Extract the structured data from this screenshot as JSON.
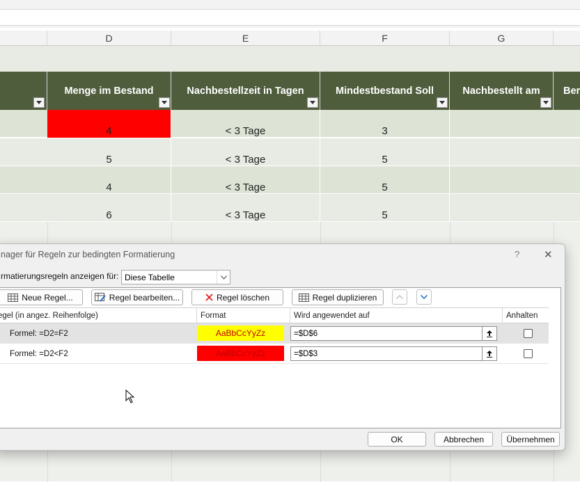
{
  "sheet": {
    "columns": [
      "D",
      "E",
      "F",
      "G"
    ],
    "headers": [
      "Menge im Bestand",
      "Nachbestellzeit in Tagen",
      "Mindestbestand Soll",
      "Nachbestellt am",
      "Ber"
    ],
    "rows": [
      {
        "d": "4",
        "e": "< 3 Tage",
        "f": "3",
        "highlight": "#ff0000"
      },
      {
        "d": "5",
        "e": "< 3 Tage",
        "f": "5"
      },
      {
        "d": "4",
        "e": "< 3 Tage",
        "f": "5"
      },
      {
        "d": "6",
        "e": "< 3 Tage",
        "f": "5"
      }
    ],
    "colors": {
      "header_bg": "#4f5d3c",
      "row_band_a": "#dde3d5",
      "row_band_b": "#e8ebe4"
    }
  },
  "dialog": {
    "title": "nager für Regeln zur bedingten Formatierung",
    "help": "?",
    "close": "✕",
    "show_label": "rmatierungsregeln anzeigen für:",
    "scope_value": "Diese Tabelle",
    "toolbar": {
      "new_rule": "Neue Regel...",
      "edit_rule": "Regel bearbeiten...",
      "delete_rule": "Regel löschen",
      "duplicate_rule": "Regel duplizieren"
    },
    "columns": {
      "rule": "egel (in angez. Reihenfolge)",
      "format": "Format",
      "applies_to": "Wird angewendet auf",
      "stop": "Anhalten"
    },
    "rules": [
      {
        "rule": "Formel: =D2=F2",
        "preview": "AaBbCcYyZz",
        "preview_bg": "#ffff00",
        "preview_fg": "#c00000",
        "applies_to": "=$D$6",
        "stop": false
      },
      {
        "rule": "Formel: =D2<F2",
        "preview": "AaBbCcYyZz",
        "preview_bg": "#ff0000",
        "preview_fg": "#c00000",
        "applies_to": "=$D$3",
        "stop": false
      }
    ],
    "buttons": {
      "ok": "OK",
      "cancel": "Abbrechen",
      "apply": "Übernehmen"
    }
  }
}
